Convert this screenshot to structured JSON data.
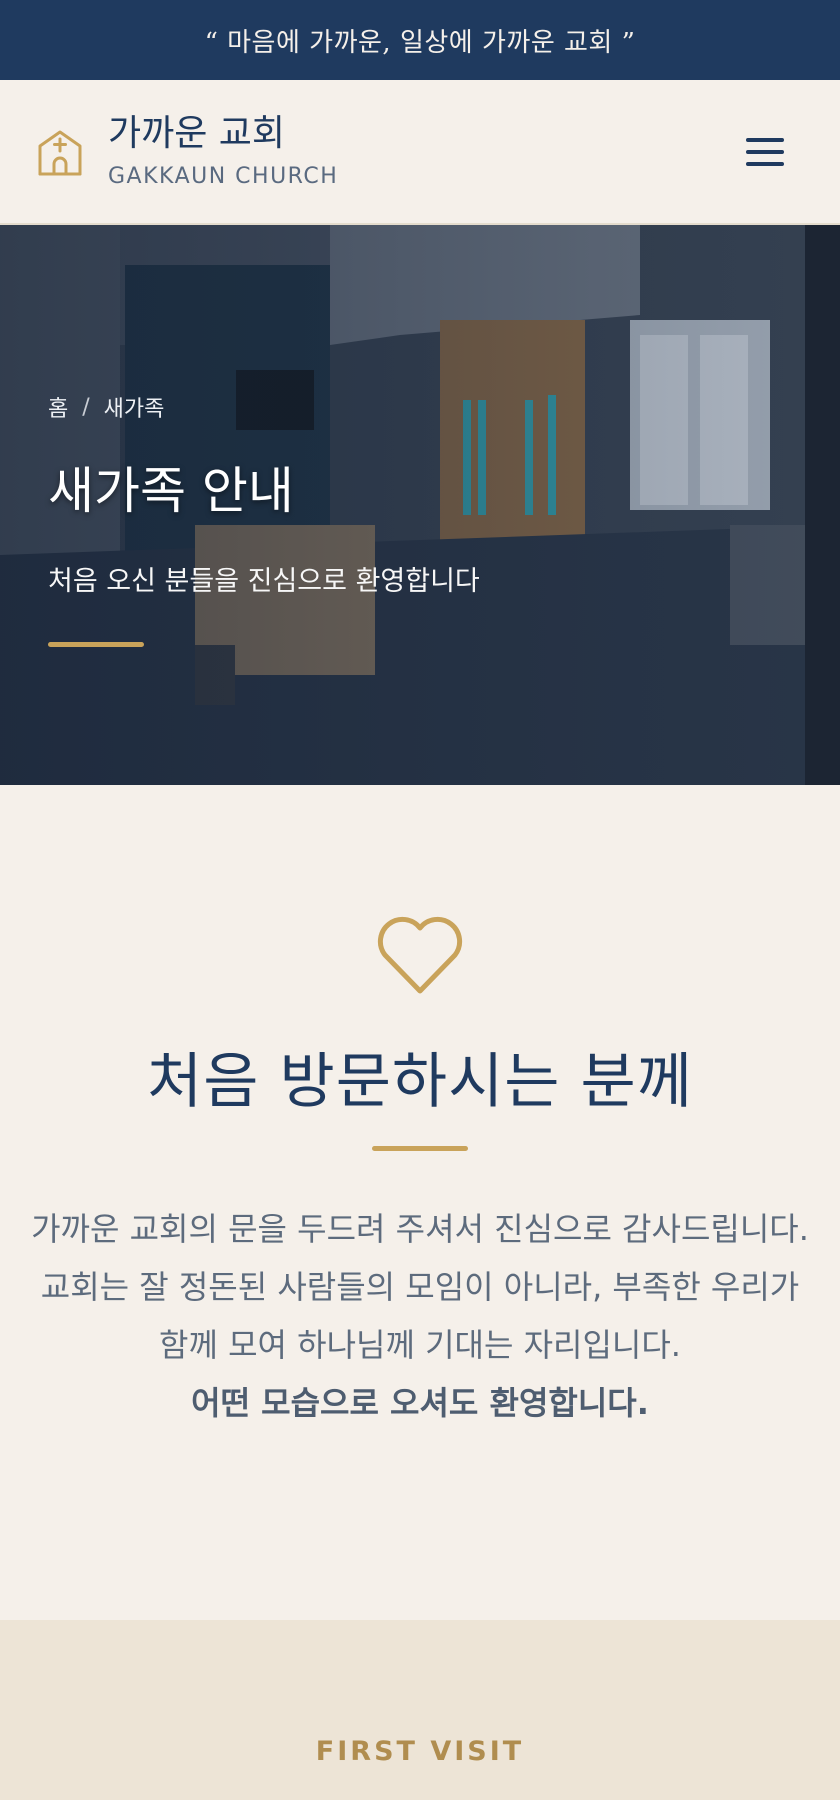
{
  "topbar": {
    "quote": "“ 마음에 가까운, 일상에 가까운 교회 ”"
  },
  "header": {
    "brand_ko": "가까운 교회",
    "brand_en": "GAKKAUN CHURCH",
    "logo_icon": "church-icon",
    "menu_icon": "hamburger-icon"
  },
  "hero": {
    "breadcrumb": [
      "홈",
      "/",
      "새가족"
    ],
    "title": "새가족 안내",
    "subtitle": "처음 오신 분들을 진심으로 환영합니다"
  },
  "welcome": {
    "icon": "heart-icon",
    "title": "처음 방문하시는 분께",
    "line1": "가까운 교회의 문을 두드려 주셔서 진심으로 감사드립니다.",
    "line2": "교회는 잘 정돈된 사람들의 모임이 아니라, 부족한 우리가 함께 모여 하나님께 기대는 자리입니다.",
    "line3": "어떤 모습으로 오셔도 환영합니다."
  },
  "visit": {
    "label": "FIRST VISIT"
  },
  "colors": {
    "navy": "#1f3a5f",
    "gold": "#c9a35a",
    "cream": "#f5f0ea",
    "sand": "#ede4d6"
  }
}
